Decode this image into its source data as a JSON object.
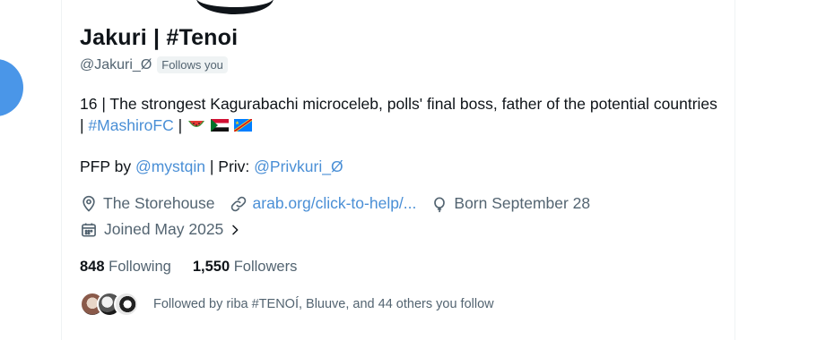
{
  "profile": {
    "display_name": "Jakuri | #Tenoi",
    "handle": "@Jakuri_Ø",
    "follows_you_badge": "Follows you",
    "bio": {
      "text_1": "16 | The strongest Kagurabachi microceleb, polls' final boss, father of the potential countries | ",
      "hashtag": "#MashiroFC",
      "text_2": " | ",
      "emojis": [
        "watermelon-icon",
        "sudan-flag-icon",
        "congo-flag-icon"
      ]
    },
    "pfp_line": {
      "prefix": "PFP by ",
      "pfp_handle": "@mystqin",
      "middle": " | Priv: ",
      "priv_handle": "@Privkuri_Ø"
    },
    "meta": {
      "location": "The Storehouse",
      "website": "arab.org/click-to-help/...",
      "birthday": "Born September 28",
      "joined": "Joined May 2025"
    },
    "stats": {
      "following_count": "848",
      "following_label": "Following",
      "followers_count": "1,550",
      "followers_label": "Followers"
    },
    "followed_by": "Followed by riba #TENOÍ, Bluuve, and 44 others you follow"
  },
  "colors": {
    "accent_link": "#4a8fd6",
    "secondary_text": "#536471",
    "primary_text": "#0f1419",
    "side_blob": "#4a96e8"
  }
}
